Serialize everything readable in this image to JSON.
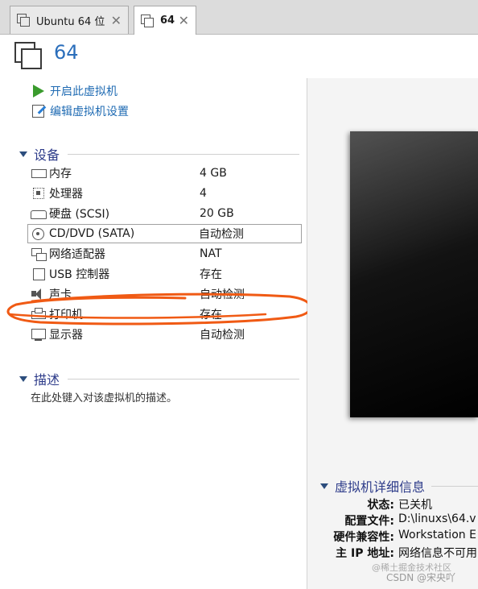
{
  "tabs": [
    {
      "label": "Ubuntu 64 位",
      "close": "✕",
      "active": false
    },
    {
      "label": "64",
      "close": "✕",
      "active": true
    }
  ],
  "header": {
    "title": "64"
  },
  "actions": {
    "power_on": "开启此虚拟机",
    "edit_settings": "编辑虚拟机设置"
  },
  "devices_section": {
    "label": "设备",
    "items": [
      {
        "name": "内存",
        "value": "4 GB",
        "icon": "memory-icon"
      },
      {
        "name": "处理器",
        "value": "4",
        "icon": "processor-icon"
      },
      {
        "name": "硬盘 (SCSI)",
        "value": "20 GB",
        "icon": "hard-disk-icon"
      },
      {
        "name": "CD/DVD (SATA)",
        "value": "自动检测",
        "icon": "cd-dvd-icon"
      },
      {
        "name": "网络适配器",
        "value": "NAT",
        "icon": "network-adapter-icon"
      },
      {
        "name": "USB 控制器",
        "value": "存在",
        "icon": "usb-icon"
      },
      {
        "name": "声卡",
        "value": "自动检测",
        "icon": "sound-card-icon"
      },
      {
        "name": "打印机",
        "value": "存在",
        "icon": "printer-icon"
      },
      {
        "name": "显示器",
        "value": "自动检测",
        "icon": "display-icon"
      }
    ],
    "selected_index": 3
  },
  "description_section": {
    "label": "描述",
    "placeholder": "在此处键入对该虚拟机的描述。"
  },
  "details_section": {
    "label": "虚拟机详细信息",
    "rows": [
      {
        "key": "状态:",
        "value": "已关机"
      },
      {
        "key": "配置文件:",
        "value": "D:\\linuxs\\64.v"
      },
      {
        "key": "硬件兼容性:",
        "value": "Workstation E"
      },
      {
        "key": "主 IP 地址:",
        "value": "网络信息不可用"
      }
    ]
  },
  "watermark": {
    "line1": "@稀土掘金技术社区",
    "line2": "CSDN @宋央吖"
  },
  "colors": {
    "link": "#1f6bb3",
    "section": "#2e3c8a",
    "annotation": "#f05a14",
    "play": "#3a9b2d"
  }
}
